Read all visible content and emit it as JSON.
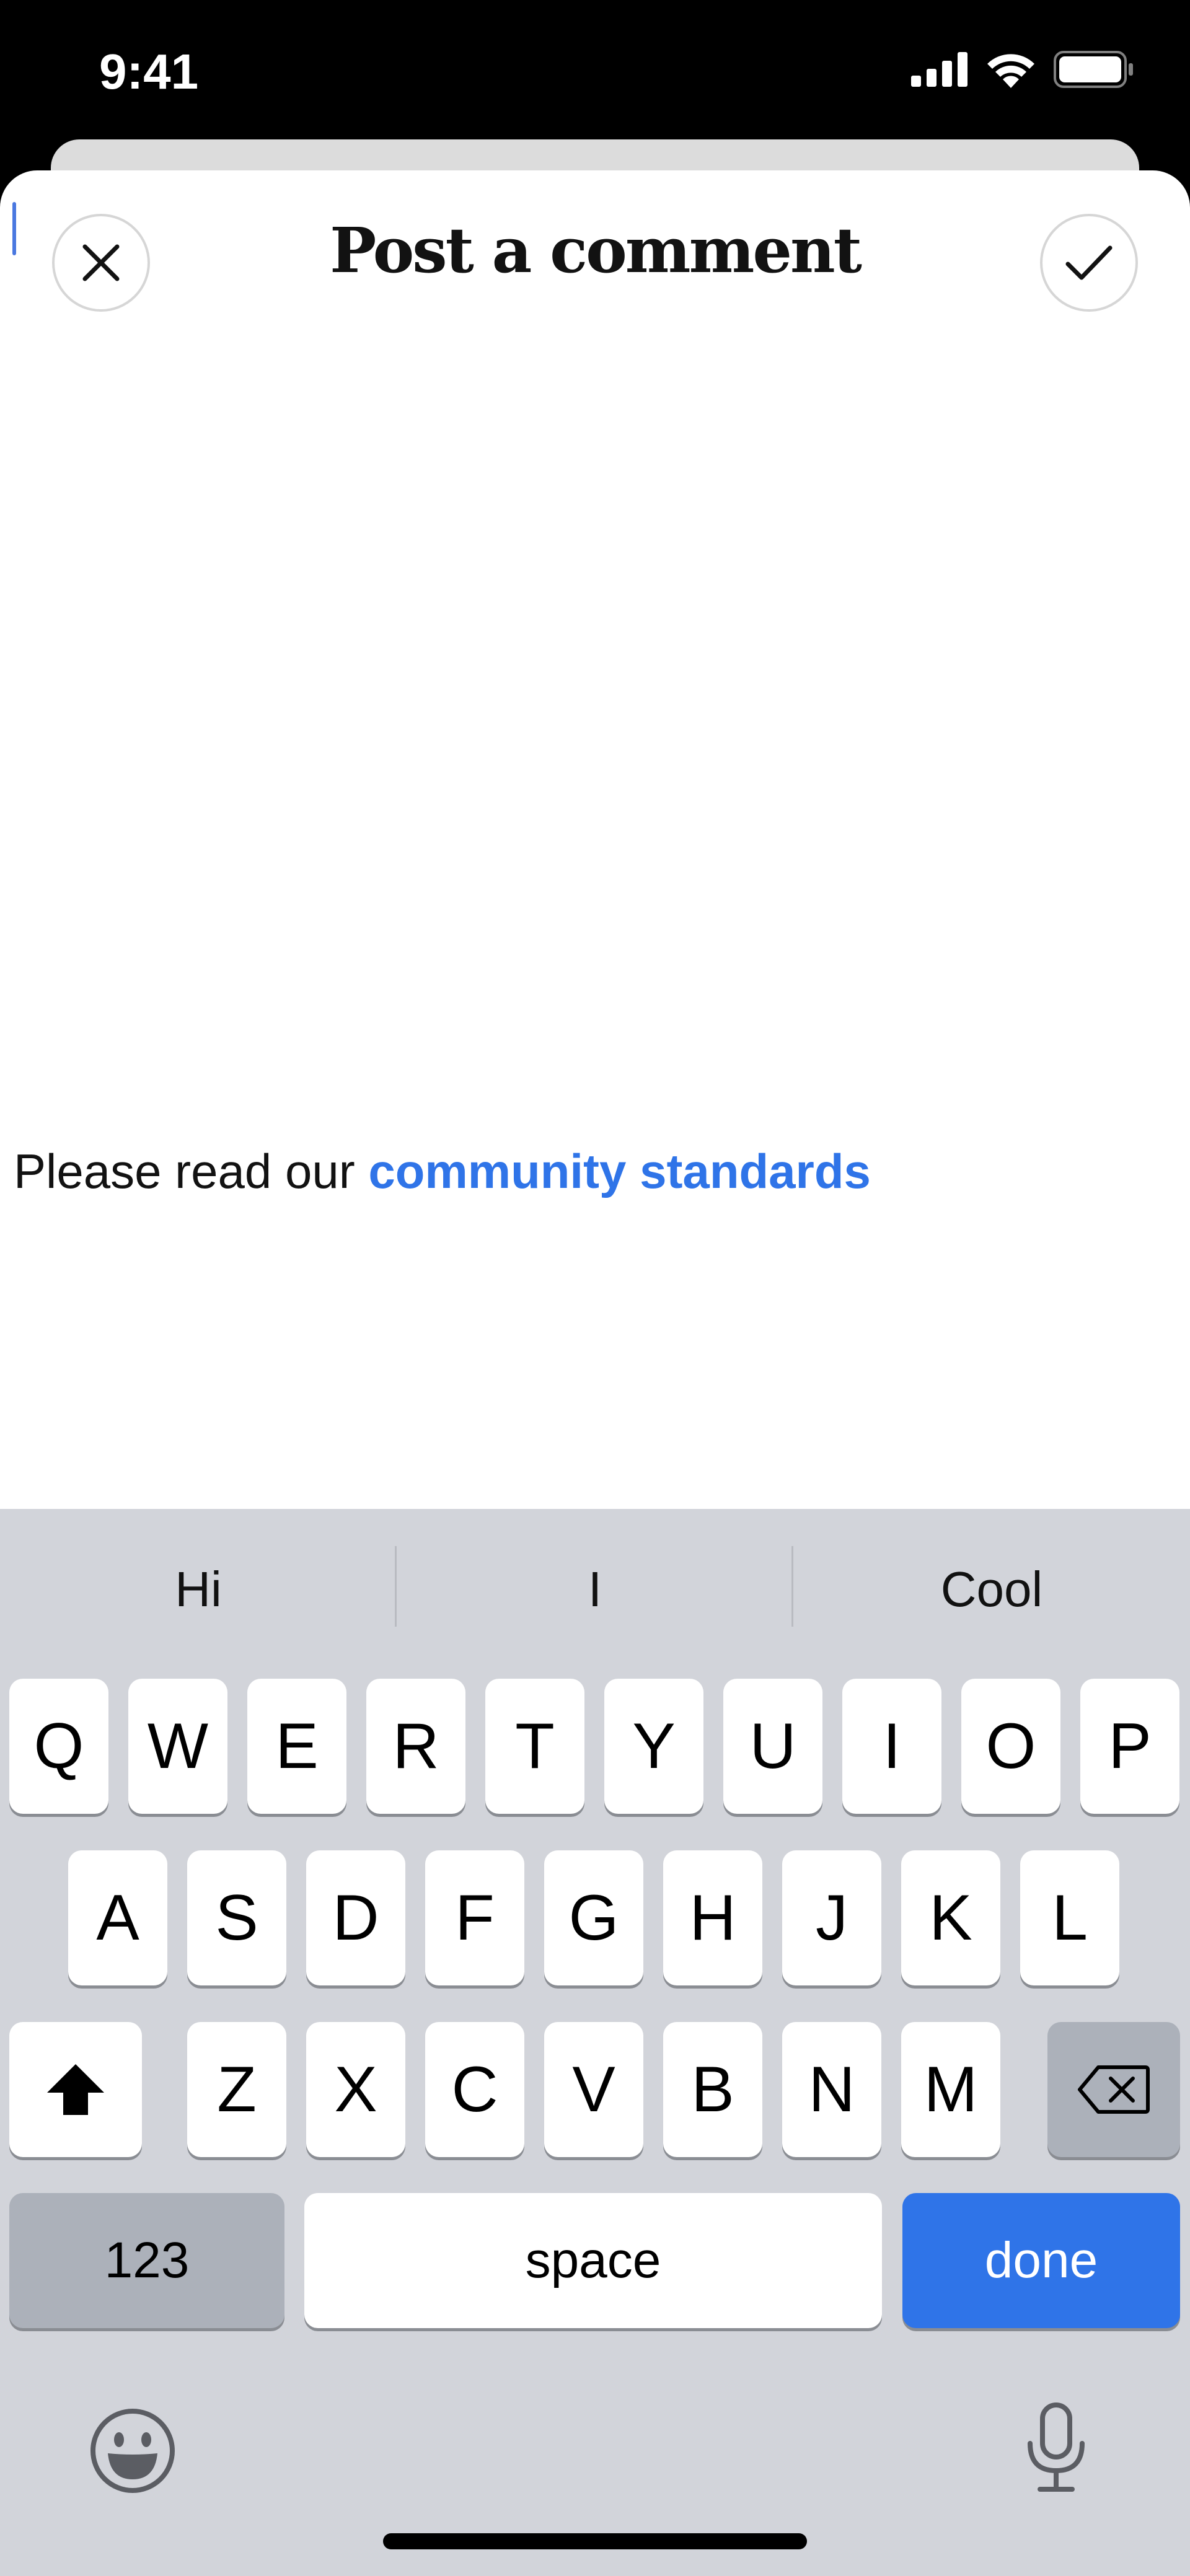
{
  "status_bar": {
    "time": "9:41"
  },
  "header": {
    "title": "Post a comment"
  },
  "comment": {
    "value": ""
  },
  "footer": {
    "prefix": "Please read our ",
    "link": "community standards"
  },
  "colors": {
    "accent": "#2f74e8",
    "keyboard_bg": "#d2d4da"
  },
  "keyboard": {
    "suggestions": [
      "Hi",
      "I",
      "Cool"
    ],
    "row1": [
      "Q",
      "W",
      "E",
      "R",
      "T",
      "Y",
      "U",
      "I",
      "O",
      "P"
    ],
    "row2": [
      "A",
      "S",
      "D",
      "F",
      "G",
      "H",
      "J",
      "K",
      "L"
    ],
    "row3": [
      "Z",
      "X",
      "C",
      "V",
      "B",
      "N",
      "M"
    ],
    "numbers_label": "123",
    "space_label": "space",
    "done_label": "done"
  }
}
